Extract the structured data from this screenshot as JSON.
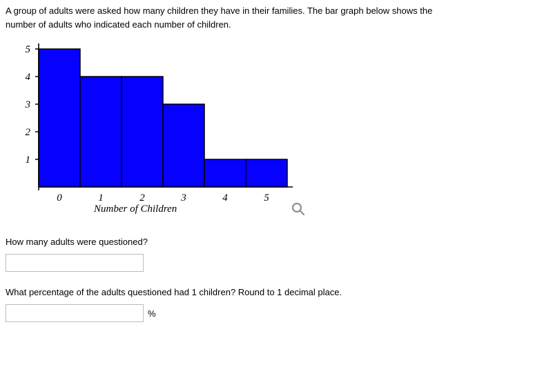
{
  "intro_line1": "A group of adults were asked how many children they have in their families. The bar graph below shows the",
  "intro_line2": "number of adults who indicated each number of children.",
  "chart_data": {
    "type": "bar",
    "categories": [
      "0",
      "1",
      "2",
      "3",
      "4",
      "5"
    ],
    "values": [
      5,
      4,
      4,
      3,
      1,
      1
    ],
    "title": "",
    "xlabel": "Number of Children",
    "ylabel": "",
    "xlim": [
      0,
      6
    ],
    "ylim": [
      0,
      5
    ],
    "yticks": [
      1,
      2,
      3,
      4,
      5
    ],
    "bar_color": "#0600ff",
    "bar_stroke": "#000000"
  },
  "question1": "How many adults were questioned?",
  "question2": "What percentage of the adults questioned had 1 children? Round to 1 decimal place.",
  "pct_symbol": "%",
  "answers": {
    "q1": "",
    "q2": ""
  }
}
